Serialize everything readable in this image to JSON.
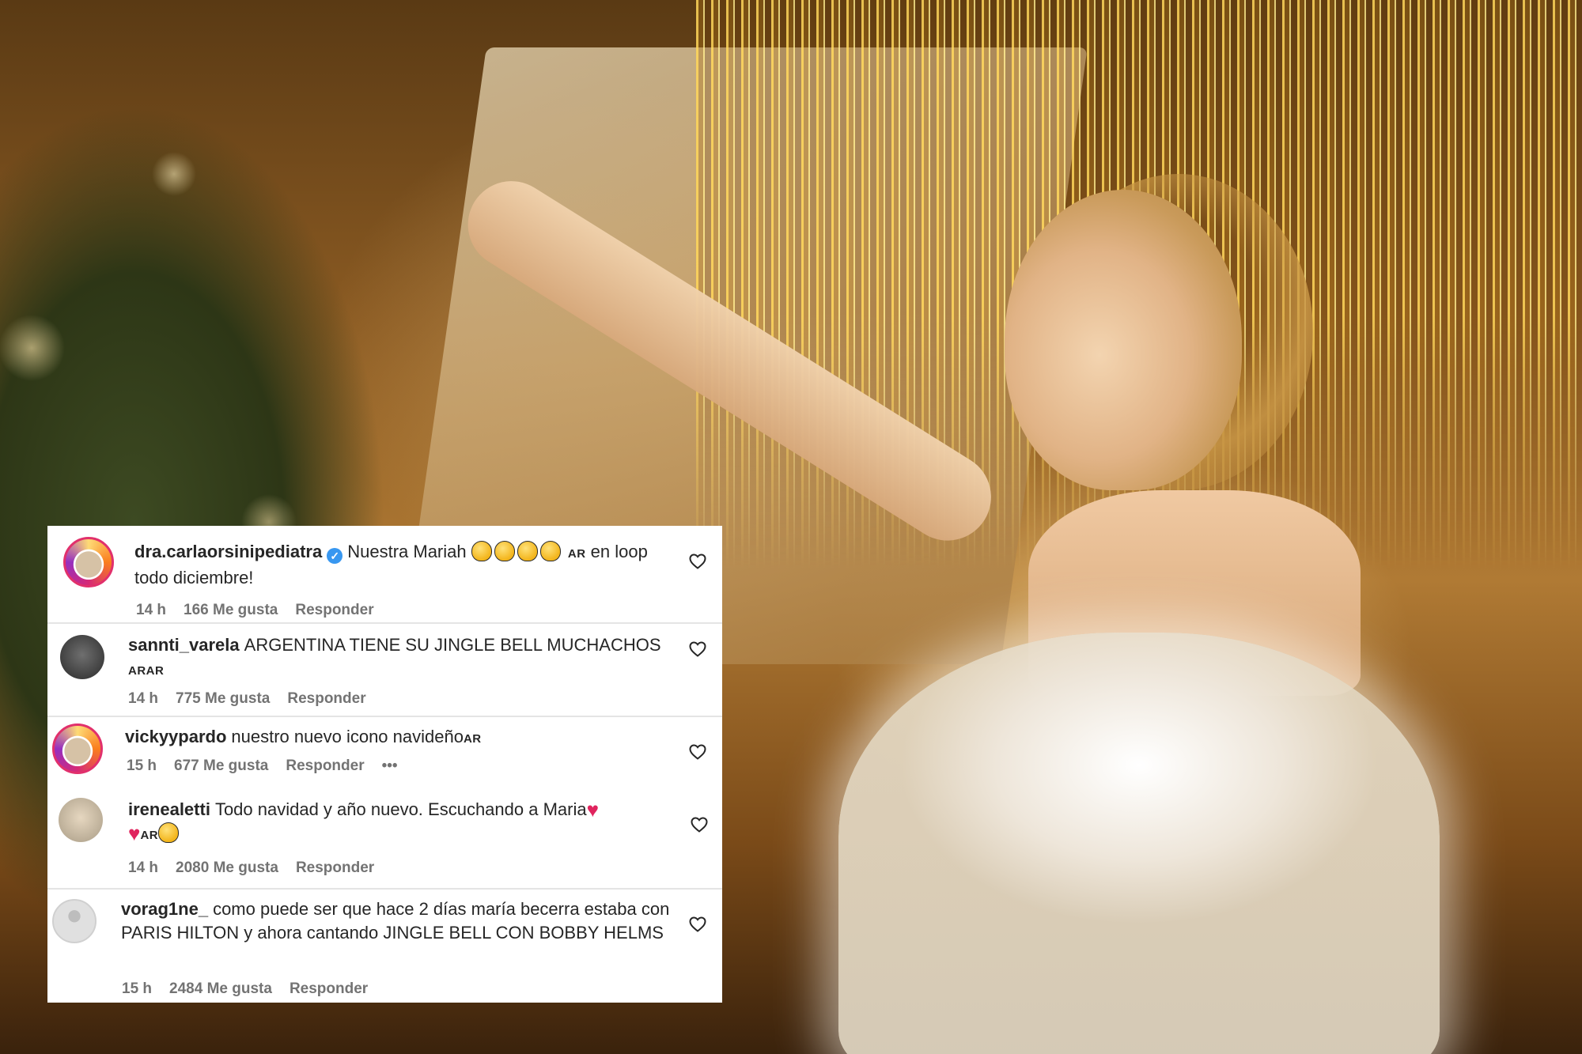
{
  "comments": [
    {
      "username": "dra.carlaorsinipediatra",
      "verified": true,
      "text_before": "Nuestra Mariah",
      "flag": "AR",
      "text_after": "en loop todo diciembre!",
      "time": "14 h",
      "likes": "166 Me gusta",
      "reply": "Responder"
    },
    {
      "username": "sannti_varela",
      "text": "ARGENTINA TIENE SU JINGLE BELL MUCHACHOS",
      "flag": "ARAR",
      "time": "14 h",
      "likes": "775 Me gusta",
      "reply": "Responder"
    },
    {
      "username": "vickyypardo",
      "text": "nuestro nuevo icono navideño",
      "flag": "AR",
      "time": "15 h",
      "likes": "677 Me gusta",
      "reply": "Responder",
      "more": "•••"
    },
    {
      "username": "irenealetti",
      "text": "Todo navidad y año nuevo. Escuchando a Maria",
      "flag": "AR",
      "time": "14 h",
      "likes": "2080 Me gusta",
      "reply": "Responder"
    },
    {
      "username": "vorag1ne_",
      "text": "como puede ser que hace 2 días maría becerra estaba con PARIS HILTON y ahora cantando JINGLE BELL CON BOBBY HELMS",
      "time": "15 h",
      "likes": "2484 Me gusta",
      "reply": "Responder"
    }
  ],
  "icons": {
    "like": "heart-outline-icon",
    "verified": "verified-badge-icon",
    "more": "more-dots-icon"
  },
  "colors": {
    "verified": "#3897f0",
    "heart_emoji": "#e0245e",
    "meta_text": "#737373"
  }
}
